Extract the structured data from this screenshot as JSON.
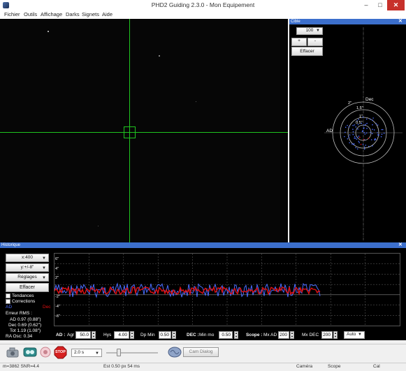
{
  "window": {
    "title": "PHD2 Guiding 2.3.0 - Mon Equipement",
    "min": "–",
    "max": "□",
    "close": "✕"
  },
  "menu": [
    "Fichier",
    "Outils",
    "Affichage",
    "Darks",
    "Signets",
    "Aide"
  ],
  "target": {
    "header": "Cible",
    "close": "✕",
    "scale_value": "100",
    "plus_label": "+",
    "minus_label": "-",
    "clear_label": "Effacer",
    "dec_label": "Dec",
    "ad_label": "AD",
    "rings": [
      "2\"",
      "1.5\"",
      "1\"",
      "0.5\""
    ]
  },
  "history": {
    "header": "Historique",
    "close": "✕",
    "x_scale": "x:400",
    "y_scale": "y:+/-8\"",
    "settings": "Réglages",
    "clear": "Effacer",
    "trends_label": "Tendances",
    "corrections_label": "Corrections",
    "ad_legend": "AD",
    "dec_legend": "Dec",
    "rms_title": "Erreur RMS :",
    "rms_ad": "AD 0.97 (0.88\")",
    "rms_dec": "Dec 0.69 (0.62\")",
    "rms_tot": "Tot 1.19 (1.08\")",
    "ra_osc": "RA Osc: 0.34",
    "y_ticks": [
      "6\"",
      "4\"",
      "2\"",
      "-2\"",
      "-4\"",
      "-6\""
    ],
    "ad_ctrl": "AD :",
    "agr_label": "Agr",
    "agr_value": "50.0",
    "hys_label": "Hys",
    "hys_value": "4.00",
    "dpmin_label": "Dp Min",
    "dpmin_value": "0.50",
    "dec_ctrl": "DEC :",
    "minmo_label": "Min mo",
    "minmo_value": "0.50",
    "scope_ctrl": "Scope :",
    "mxad_label": "Mx AD",
    "mxad_value": "200",
    "mxdec_label": "Mx DEC",
    "mxdec_value": "200",
    "mode_value": "Auto"
  },
  "toolbar": {
    "exposure": "2.0 s",
    "stop_label": "STOP",
    "cam_dialog": "Cam Dialog"
  },
  "status": {
    "star": "m=3862 SNR=4.4",
    "est": "Est  0.50 px  54 ms",
    "camera": "Caméra",
    "scope": "Scope",
    "cal": "Cal"
  },
  "colors": {
    "ra": "#4a6cff",
    "dec": "#e01010",
    "reticle": "#1fc41f",
    "panel_header": "#3c6fcc"
  }
}
